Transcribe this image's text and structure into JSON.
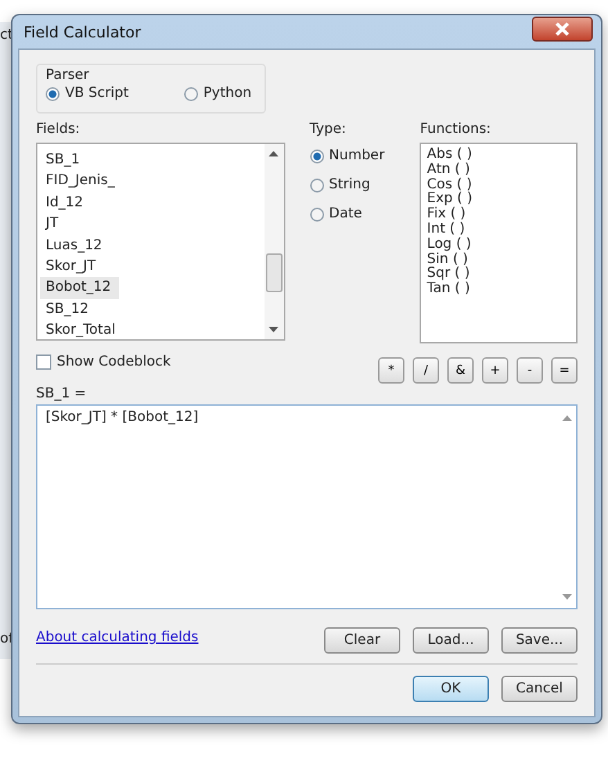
{
  "background_window": {
    "texts": [
      "ct",
      "of"
    ]
  },
  "window": {
    "title": "Field Calculator"
  },
  "parser": {
    "label": "Parser",
    "options": [
      {
        "label": "VB Script",
        "selected": true
      },
      {
        "label": "Python",
        "selected": false
      }
    ]
  },
  "fields": {
    "label": "Fields:",
    "items": [
      {
        "label": "SB_1",
        "selected": false
      },
      {
        "label": "FID_Jenis_",
        "selected": false
      },
      {
        "label": "Id_12",
        "selected": false
      },
      {
        "label": "JT",
        "selected": false
      },
      {
        "label": "Luas_12",
        "selected": false
      },
      {
        "label": "Skor_JT",
        "selected": false
      },
      {
        "label": "Bobot_12",
        "selected": true
      },
      {
        "label": "SB_12",
        "selected": false
      },
      {
        "label": "Skor_Total",
        "selected": false
      }
    ]
  },
  "type": {
    "label": "Type:",
    "options": [
      {
        "label": "Number",
        "selected": true
      },
      {
        "label": "String",
        "selected": false
      },
      {
        "label": "Date",
        "selected": false
      }
    ]
  },
  "functions": {
    "label": "Functions:",
    "items": [
      "Abs ( )",
      "Atn ( )",
      "Cos ( )",
      "Exp ( )",
      "Fix ( )",
      "Int ( )",
      "Log ( )",
      "Sin ( )",
      "Sqr ( )",
      "Tan ( )"
    ]
  },
  "show_codeblock": {
    "label": "Show Codeblock",
    "checked": false
  },
  "operators": [
    "*",
    "/",
    "&",
    "+",
    "-",
    "="
  ],
  "expression": {
    "label": "SB_1 =",
    "value": "[Skor_JT] * [Bobot_12]"
  },
  "help_link": "About calculating fields",
  "file_buttons": [
    "Clear",
    "Load...",
    "Save..."
  ],
  "dialog_buttons": [
    {
      "label": "OK",
      "kind": "default"
    },
    {
      "label": "Cancel",
      "kind": "normal"
    }
  ]
}
